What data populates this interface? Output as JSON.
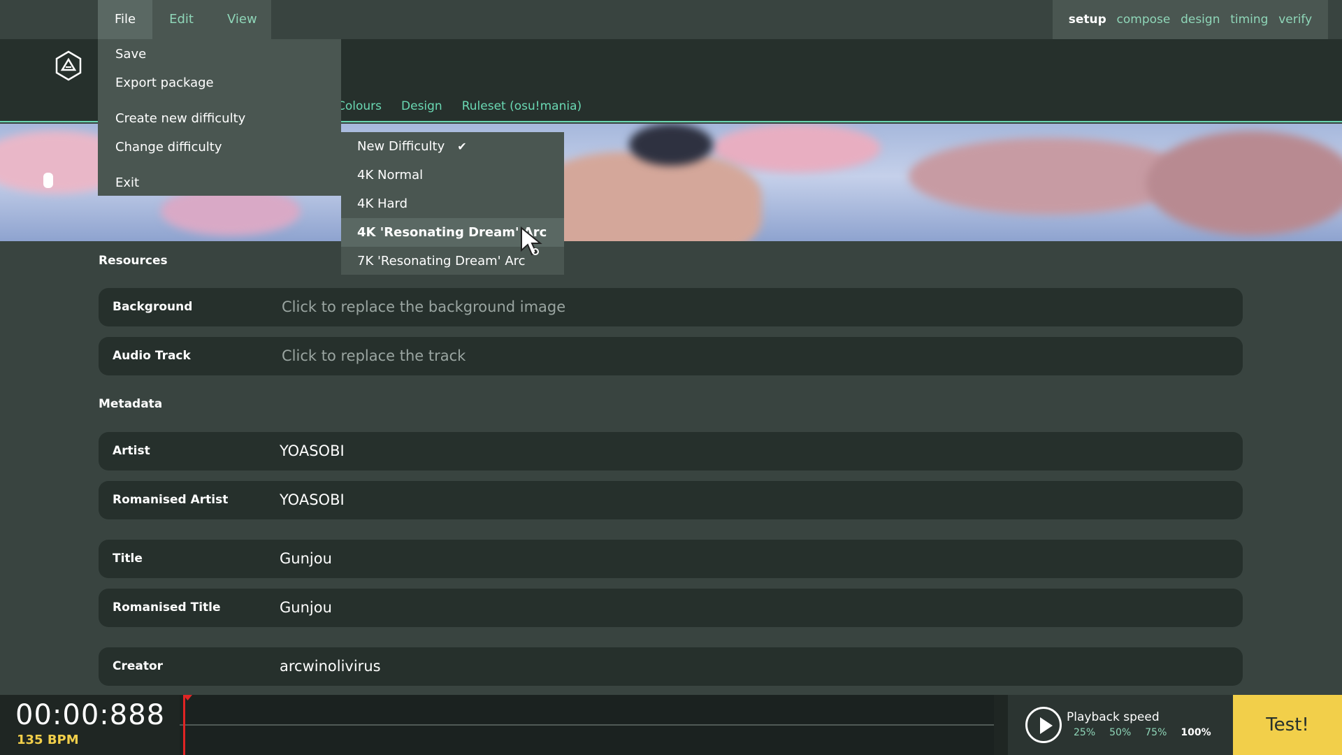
{
  "menu": {
    "file": "File",
    "edit": "Edit",
    "view": "View"
  },
  "mode_tabs": {
    "setup": "setup",
    "compose": "compose",
    "design": "design",
    "timing": "timing",
    "verify": "verify"
  },
  "section_tabs": {
    "colours": "Colours",
    "design": "Design",
    "ruleset": "Ruleset (osu!mania)"
  },
  "file_menu": {
    "save": "Save",
    "export": "Export package",
    "create_difficulty": "Create new difficulty",
    "change_difficulty": "Change difficulty",
    "exit": "Exit"
  },
  "difficulty_menu": {
    "items": [
      "New Difficulty",
      "4K Normal",
      "4K Hard",
      "4K 'Resonating Dream' Arc",
      "7K 'Resonating Dream' Arc"
    ],
    "checked_index": 0,
    "hover_index": 3
  },
  "resources": {
    "title": "Resources",
    "background_label": "Background",
    "background_placeholder": "Click to replace the background image",
    "audio_label": "Audio Track",
    "audio_placeholder": "Click to replace the track"
  },
  "metadata": {
    "title": "Metadata",
    "artist_label": "Artist",
    "artist_value": "YOASOBI",
    "romanised_artist_label": "Romanised Artist",
    "romanised_artist_value": "YOASOBI",
    "title_label": "Title",
    "title_value": "Gunjou",
    "romanised_title_label": "Romanised Title",
    "romanised_title_value": "Gunjou",
    "creator_label": "Creator",
    "creator_value": "arcwinolivirus"
  },
  "bottom": {
    "time": "00:00:888",
    "bpm": "135 BPM",
    "playback_label": "Playback speed",
    "speeds": [
      "25%",
      "50%",
      "75%",
      "100%"
    ],
    "active_speed": "100%",
    "test": "Test!"
  },
  "colors": {
    "accent": "#6ad8b3",
    "test_button": "#f2cf4a",
    "playhead": "#e02424"
  }
}
